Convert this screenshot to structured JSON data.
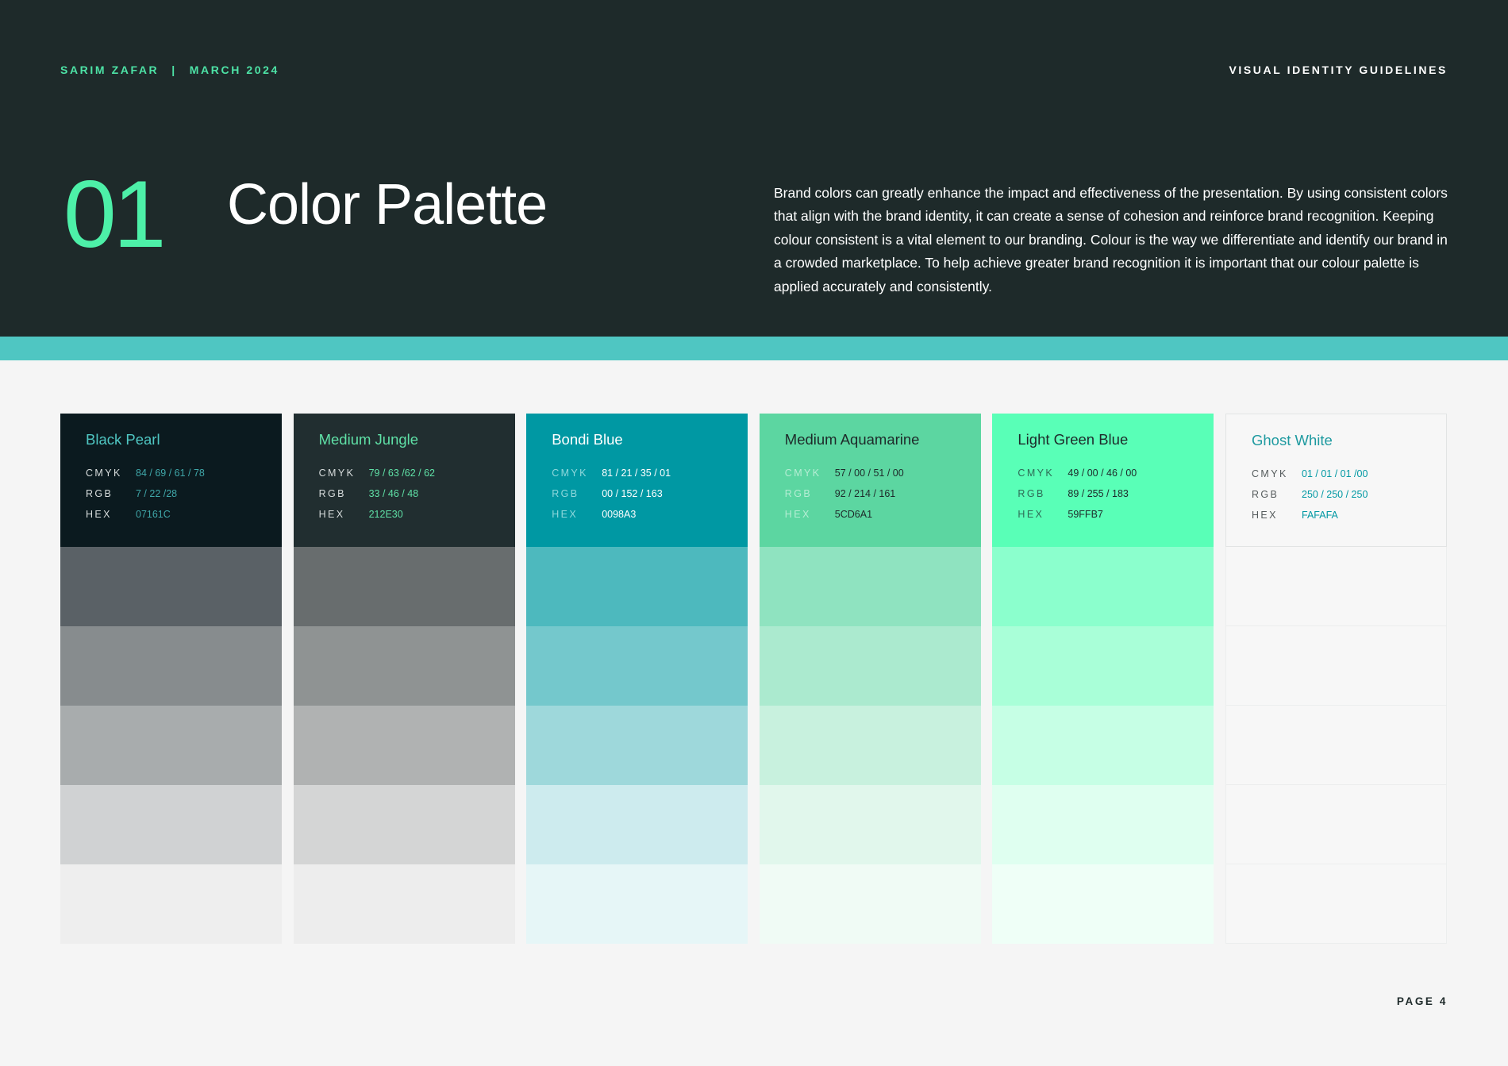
{
  "header": {
    "author": "SARIM ZAFAR",
    "separator": "|",
    "date": "MARCH 2024",
    "doc_title": "VISUAL IDENTITY GUIDELINES",
    "section_number": "01",
    "section_title": "Color Palette",
    "intro": "Brand colors can greatly enhance the impact and effectiveness of the presentation. By using consistent colors that align with the brand identity, it can create a sense of cohesion and reinforce brand recognition. Keeping colour consistent is a vital element to our branding. Colour is the way we differentiate and identify our brand in a crowded marketplace. To help achieve greater brand recognition it is important that our colour palette is applied accurately and consistently."
  },
  "spec_labels": {
    "cmyk": "CMYK",
    "rgb": "RGB",
    "hex": "HEX"
  },
  "colors": [
    {
      "name": "Black Pearl",
      "cmyk": "84 / 69 / 61 / 78",
      "rgb": "7 / 22 /28",
      "hex": "07161C",
      "swatch": "#0B1A1F",
      "name_color": "#4FC6C2",
      "label_color": "#D7DCDC",
      "value_color": "#3FA6A8",
      "tints": [
        "#5A6166",
        "#878C8E",
        "#A8ACAD",
        "#D0D2D3",
        "#EEEEEE"
      ]
    },
    {
      "name": "Medium Jungle",
      "cmyk": "79 / 63 /62 / 62",
      "rgb": "33 / 46 / 48",
      "hex": "212E30",
      "swatch": "#212E30",
      "name_color": "#5FE0A6",
      "label_color": "#D7DCDC",
      "value_color": "#5FE0A6",
      "tints": [
        "#686D6E",
        "#8F9393",
        "#B0B2B2",
        "#D4D5D5",
        "#EDEDED"
      ]
    },
    {
      "name": "Bondi Blue",
      "cmyk": "81 / 21 / 35 / 01",
      "rgb": "00 / 152 / 163",
      "hex": "0098A3",
      "swatch": "#0098A3",
      "name_color": "#FFFFFF",
      "label_color": "#8FD8DC",
      "value_color": "#FFFFFF",
      "tints": [
        "#4DB9BE",
        "#74C8CC",
        "#9ED8DB",
        "#CDEBEE",
        "#E6F6F7"
      ]
    },
    {
      "name": "Medium Aquamarine",
      "cmyk": "57 / 00 / 51 / 00",
      "rgb": "92 / 214 / 161",
      "hex": "5CD6A1",
      "swatch": "#5CD6A1",
      "name_color": "#1E2A2A",
      "label_color": "#B5EDD4",
      "value_color": "#1E2A2A",
      "tints": [
        "#8FE3C0",
        "#ABEACF",
        "#C8F1DE",
        "#E1F7EC",
        "#F0FBF5"
      ]
    },
    {
      "name": "Light Green Blue",
      "cmyk": "49 / 00 / 46 / 00",
      "rgb": "89 / 255 / 183",
      "hex": "59FFB7",
      "swatch": "#59FFB7",
      "name_color": "#1E2A2A",
      "label_color": "#2E6B55",
      "value_color": "#1E2A2A",
      "tints": [
        "#8BFFCD",
        "#A9FFD8",
        "#C6FFE5",
        "#DFFFF0",
        "#EFFFF7"
      ]
    },
    {
      "name": "Ghost White",
      "cmyk": "01 / 01 / 01 /00",
      "rgb": "250 / 250 / 250",
      "hex": "FAFAFA",
      "swatch": "#F7F7F7",
      "name_color": "#1E9AA0",
      "label_color": "#555B5C",
      "value_color": "#0098A3",
      "tints": [
        "#F7F7F7",
        "#F7F7F7",
        "#F7F7F7",
        "#F7F7F7",
        "#F7F7F7"
      ]
    }
  ],
  "page": "PAGE 4"
}
